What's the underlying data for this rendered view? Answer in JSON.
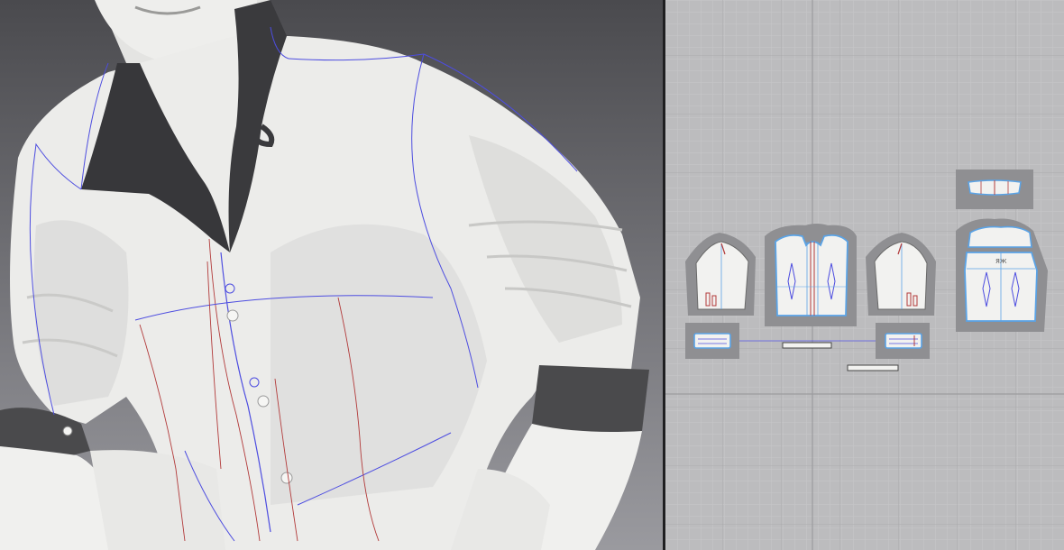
{
  "app": {
    "views": [
      {
        "id": "avatar-3d-view",
        "kind": "3D garment view"
      },
      {
        "id": "pattern-2d-view",
        "kind": "2D pattern window"
      }
    ]
  },
  "colors": {
    "viewport_3d_top": "#4a4a4e",
    "viewport_3d_bottom": "#9a9a9f",
    "pattern_background": "#bcbcbe",
    "grid_minor": "#c7c7c9",
    "grid_major": "#a9a9ab",
    "shirt_fabric": "#ecece9",
    "collar_fabric": "#37373a",
    "cuff_fabric": "#4a4a4c",
    "seam_line_blue": "#4d4de0",
    "internal_line_red": "#b23a3a",
    "piece_fill": "#f2f2f0",
    "piece_outline": "#5aa3e6",
    "piece_shadow": "#8f8f92"
  },
  "pattern_pieces": [
    {
      "name": "left-sleeve",
      "icon": "sleeve-piece-icon"
    },
    {
      "name": "front-body",
      "icon": "front-piece-icon"
    },
    {
      "name": "right-sleeve",
      "icon": "sleeve-piece-icon"
    },
    {
      "name": "collar-stand",
      "icon": "collar-piece-icon"
    },
    {
      "name": "back-body",
      "icon": "back-piece-icon"
    },
    {
      "name": "left-cuff",
      "icon": "cuff-piece-icon"
    },
    {
      "name": "right-cuff",
      "icon": "cuff-piece-icon"
    },
    {
      "name": "button-placket",
      "icon": "placket-piece-icon"
    },
    {
      "name": "collar-band-strip",
      "icon": "strip-piece-icon"
    }
  ]
}
